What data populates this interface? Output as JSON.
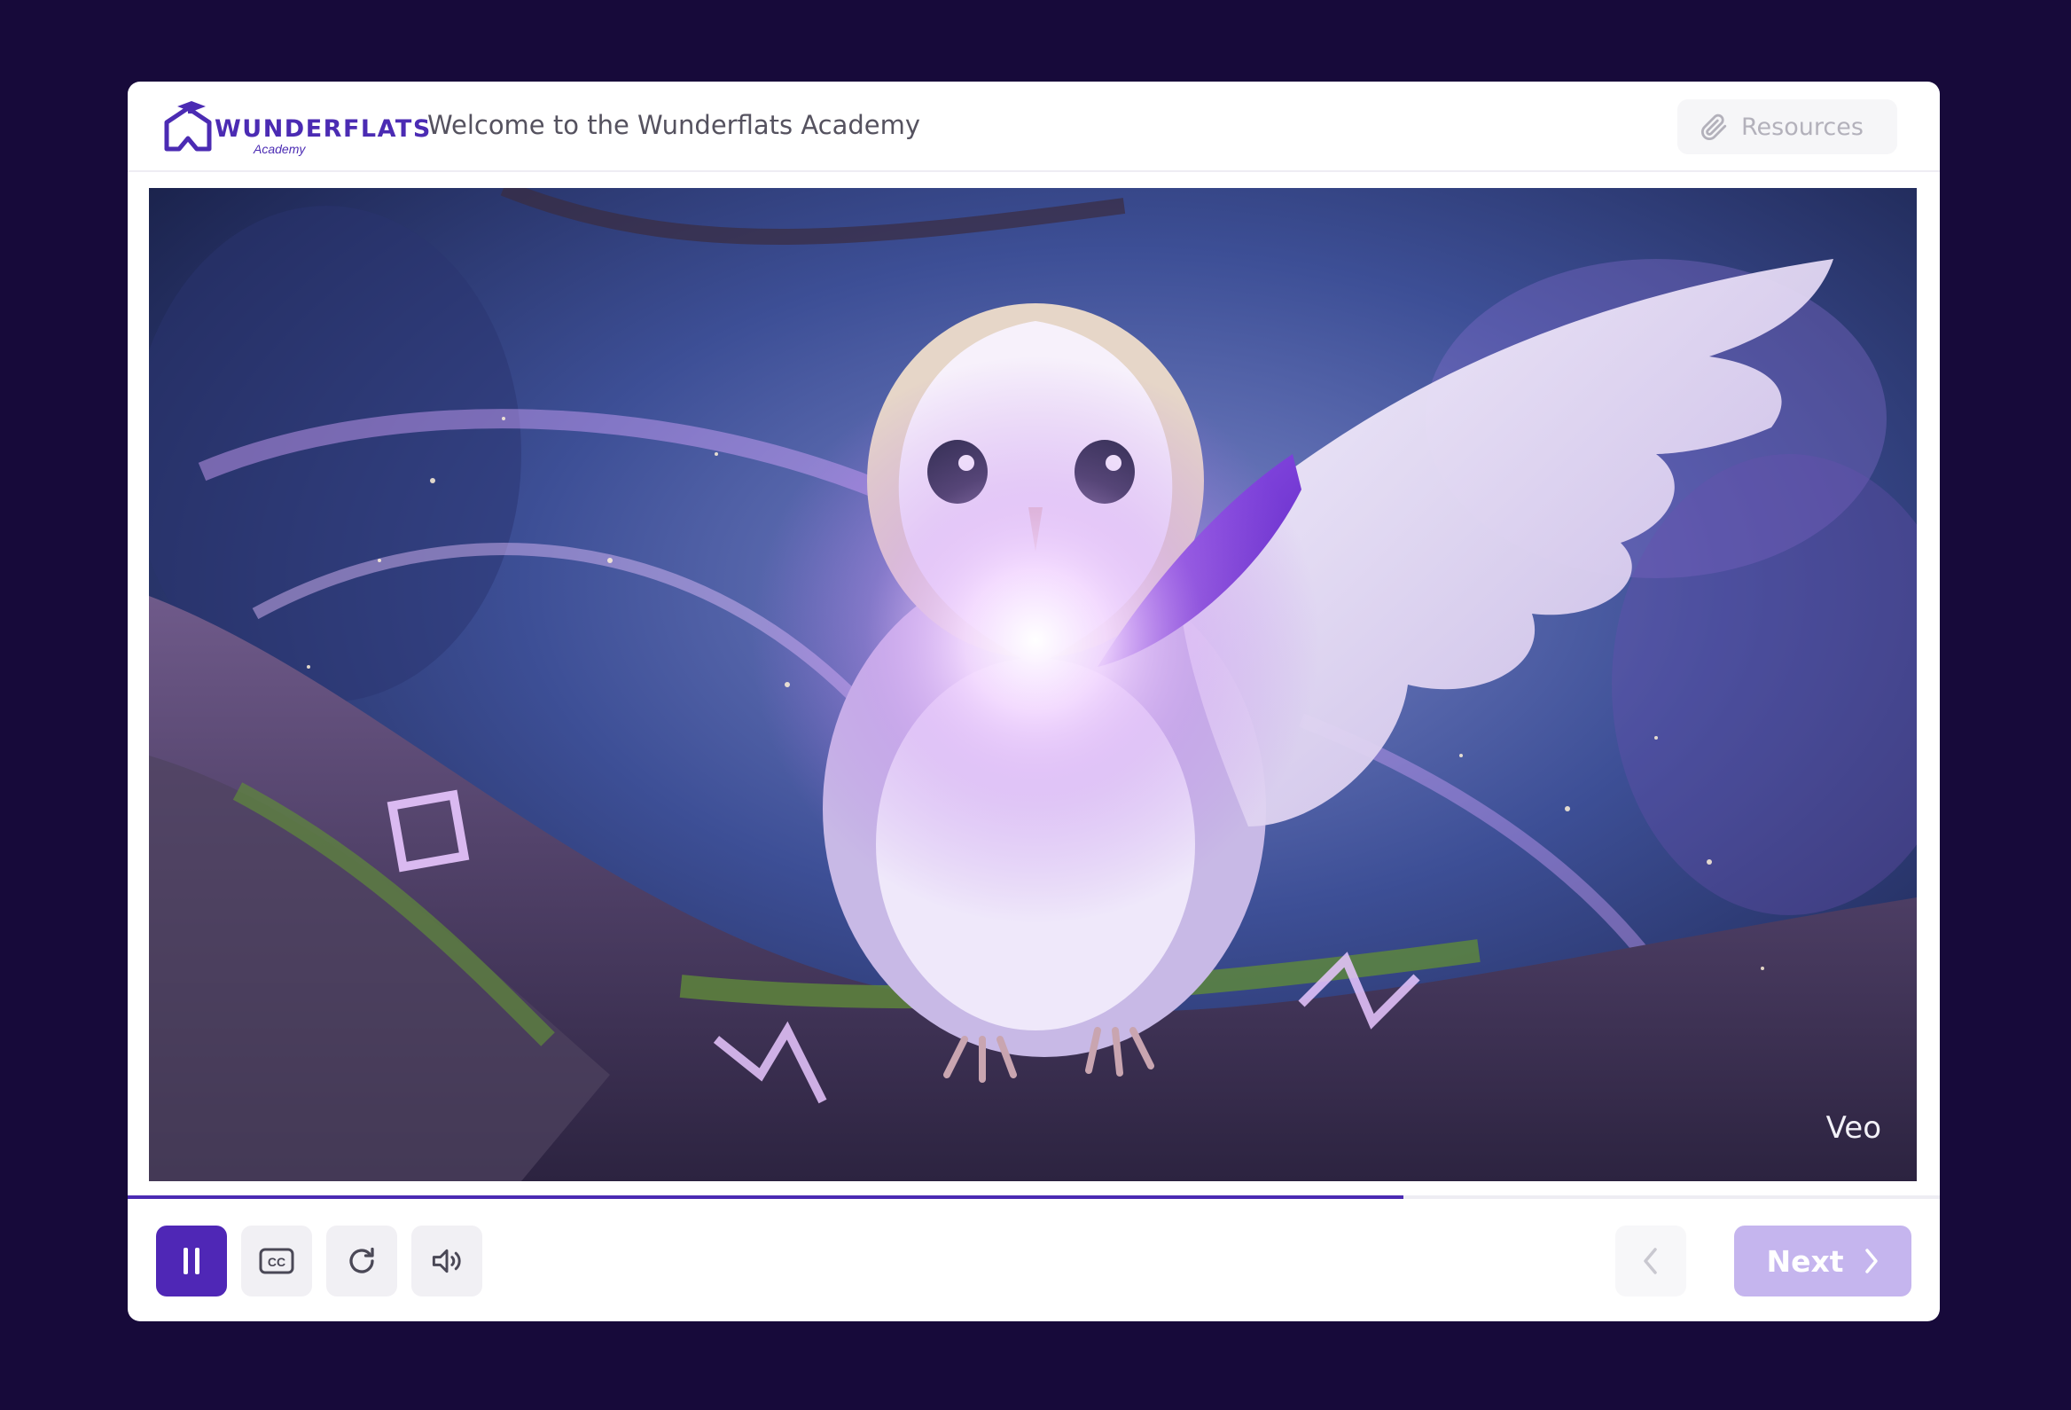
{
  "header": {
    "logo_text": "WUNDERFLATS",
    "logo_sub": "Academy",
    "title": "Welcome to the Wunderflats Academy",
    "resources_label": "Resources"
  },
  "video": {
    "watermark": "Veo",
    "progress": 0.704
  },
  "controls": {
    "play_state": "playing",
    "next_label": "Next"
  },
  "colors": {
    "background": "#170a3a",
    "brand": "#4b2bb3",
    "next_button": "#c5b5ee"
  },
  "icons": [
    "logo-house-icon",
    "paperclip-icon",
    "pause-icon",
    "closed-captions-icon",
    "replay-icon",
    "volume-icon",
    "chevron-left-icon",
    "chevron-right-icon"
  ]
}
